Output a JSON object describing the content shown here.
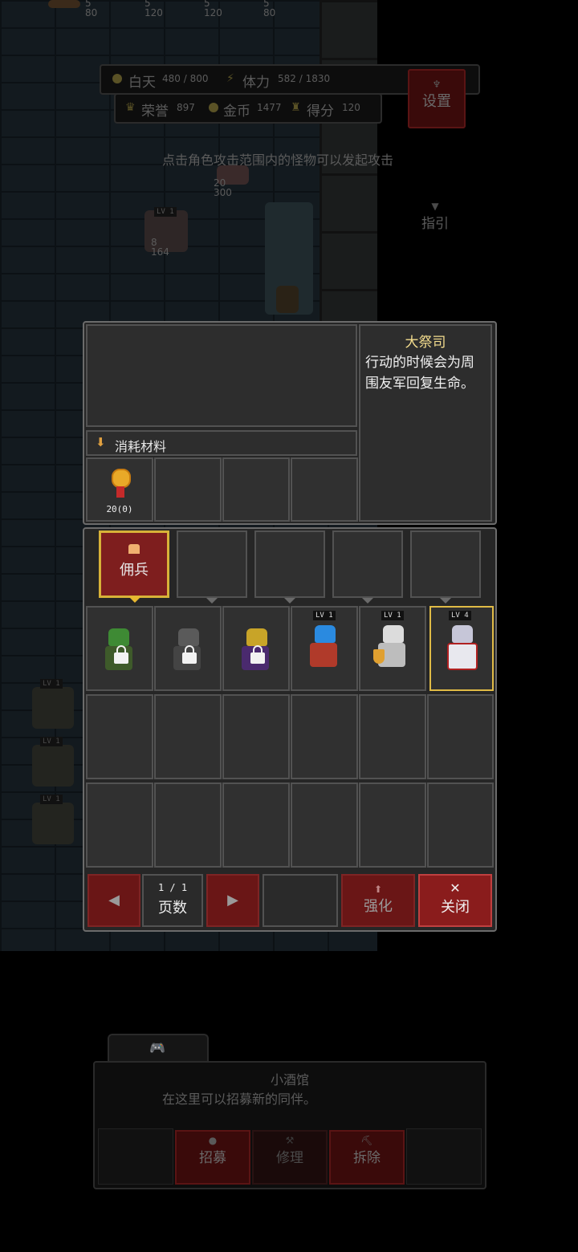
{
  "hud": {
    "day_label": "白天",
    "day_value": "480 / 800",
    "stamina_label": "体力",
    "stamina_value": "582 / 1830",
    "honor_label": "荣誉",
    "honor_value": "897",
    "gold_label": "金币",
    "gold_value": "1477",
    "score_label": "得分",
    "score_value": "120",
    "settings_label": "设置",
    "guide_label": "指引",
    "hint": "点击角色攻击范围内的怪物可以发起攻击"
  },
  "world": {
    "top_units": [
      {
        "atk": "5",
        "hp": "80"
      },
      {
        "atk": "5",
        "hp": "120"
      },
      {
        "atk": "5",
        "hp": "120"
      },
      {
        "atk": "5",
        "hp": "80"
      }
    ],
    "enemy": {
      "atk": "20",
      "hp": "300"
    },
    "hero": {
      "level": "LV 1",
      "atk": "8",
      "hp": "164"
    },
    "buildings": [
      {
        "level": "LV 1"
      },
      {
        "level": "LV 1"
      },
      {
        "level": "LV 1"
      }
    ]
  },
  "dialog": {
    "info_title": "大祭司",
    "info_desc": "行动的时候会为周围友军回复生命。",
    "materials_header": "消耗材料",
    "material_cost": "20(0)",
    "category_tab": "佣兵",
    "heroes": [
      {
        "name": "green-hood-archer",
        "locked": true,
        "level": ""
      },
      {
        "name": "grey-knight",
        "locked": true,
        "level": ""
      },
      {
        "name": "purple-mage",
        "locked": true,
        "level": ""
      },
      {
        "name": "blue-hair-archer",
        "locked": false,
        "level": "LV 1"
      },
      {
        "name": "shield-paladin",
        "locked": false,
        "level": "LV 1"
      },
      {
        "name": "high-priest",
        "locked": false,
        "level": "LV 4",
        "selected": true
      }
    ],
    "page_value": "1 / 1",
    "page_label": "页数",
    "upgrade_label": "强化",
    "close_label": "关闭"
  },
  "tavern": {
    "title": "小酒馆",
    "desc": "在这里可以招募新的同伴。",
    "recruit_label": "招募",
    "repair_label": "修理",
    "demolish_label": "拆除"
  }
}
